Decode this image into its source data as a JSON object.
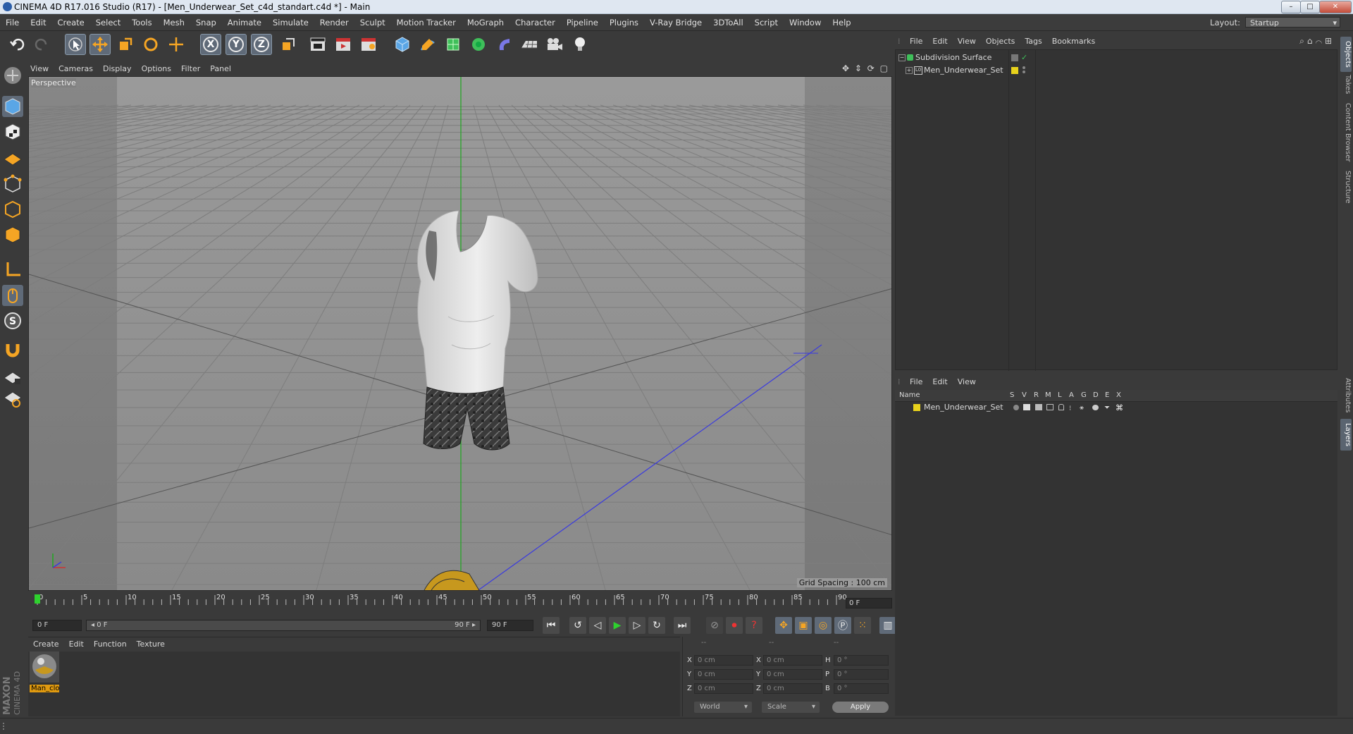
{
  "window": {
    "title": "CINEMA 4D R17.016 Studio (R17) - [Men_Underwear_Set_c4d_standart.c4d *] - Main",
    "controls": [
      "–",
      "□",
      "✕"
    ]
  },
  "menubar": {
    "items": [
      "File",
      "Edit",
      "Create",
      "Select",
      "Tools",
      "Mesh",
      "Snap",
      "Animate",
      "Simulate",
      "Render",
      "Sculpt",
      "Motion Tracker",
      "MoGraph",
      "Character",
      "Pipeline",
      "Plugins",
      "V-Ray Bridge",
      "3DToAll",
      "Script",
      "Window",
      "Help"
    ],
    "layout_label": "Layout:",
    "layout_value": "Startup"
  },
  "toolbar": {
    "axis_labels": [
      "X",
      "Y",
      "Z"
    ]
  },
  "viewport": {
    "menu": [
      "View",
      "Cameras",
      "Display",
      "Options",
      "Filter",
      "Panel"
    ],
    "label": "Perspective",
    "grid_spacing": "Grid Spacing : 100 cm"
  },
  "timeline": {
    "ticks": [
      "0",
      "5",
      "10",
      "15",
      "20",
      "25",
      "30",
      "35",
      "40",
      "45",
      "50",
      "55",
      "60",
      "65",
      "70",
      "75",
      "80",
      "85",
      "90"
    ],
    "current_frame": "0 F",
    "start_field": "0 F",
    "range_start": "◂ 0 F",
    "range_end": "90 F ▸",
    "end_field": "90 F"
  },
  "material_manager": {
    "menu": [
      "Create",
      "Edit",
      "Function",
      "Texture"
    ],
    "materials": [
      {
        "name": "Man_clo"
      }
    ]
  },
  "branding": {
    "maxon": "MAXON",
    "product": "CINEMA 4D"
  },
  "coordinates": {
    "header": [
      "--",
      "--",
      "--"
    ],
    "rows": [
      {
        "l1": "X",
        "v1": "0 cm",
        "l2": "X",
        "v2": "0 cm",
        "l3": "H",
        "v3": "0 °"
      },
      {
        "l1": "Y",
        "v1": "0 cm",
        "l2": "Y",
        "v2": "0 cm",
        "l3": "P",
        "v3": "0 °"
      },
      {
        "l1": "Z",
        "v1": "0 cm",
        "l2": "Z",
        "v2": "0 cm",
        "l3": "B",
        "v3": "0 °"
      }
    ],
    "mode_world": "World",
    "mode_scale": "Scale",
    "apply": "Apply"
  },
  "object_manager": {
    "menu": [
      "File",
      "Edit",
      "View",
      "Objects",
      "Tags",
      "Bookmarks"
    ],
    "objects": [
      {
        "name": "Subdivision Surface"
      },
      {
        "name": "Men_Underwear_Set"
      }
    ]
  },
  "layer_manager": {
    "menu": [
      "File",
      "Edit",
      "View"
    ],
    "columns": [
      "Name",
      "S",
      "V",
      "R",
      "M",
      "L",
      "A",
      "G",
      "D",
      "E",
      "X"
    ],
    "layers": [
      {
        "name": "Men_Underwear_Set",
        "color": "#e8d21c"
      }
    ]
  },
  "right_tabs": [
    "Objects",
    "Takes",
    "Content Browser",
    "Structure",
    "Attributes",
    "Layers"
  ],
  "colors": {
    "accent_select": "#5f6a78",
    "layer_yellow": "#e8d21c",
    "object_green": "#3fbf5a",
    "axis_green": "#1fa81f",
    "axis_blue": "#3a3adf"
  }
}
